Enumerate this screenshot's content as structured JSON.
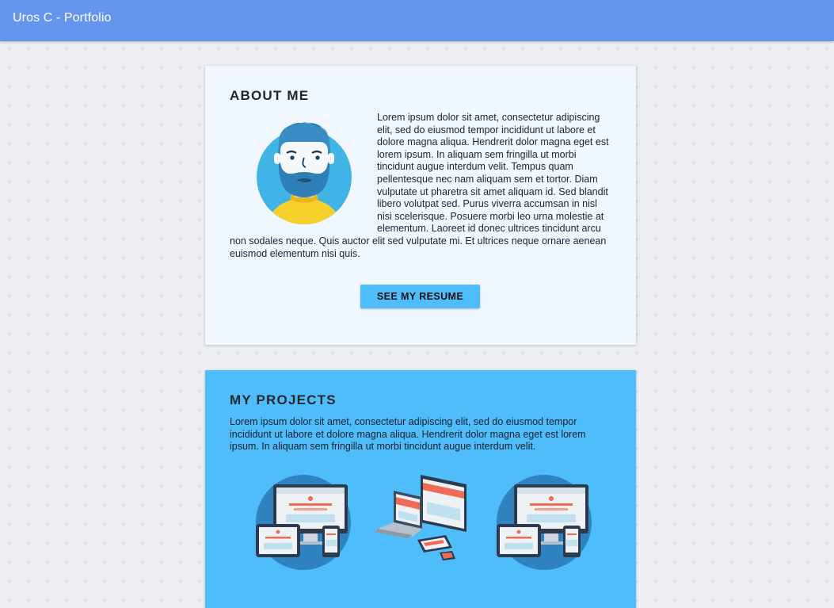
{
  "topbar": {
    "title": "Uros C - Portfolio"
  },
  "about": {
    "heading": "ABOUT ME",
    "avatar_icon": "bearded-man-avatar-icon",
    "body": "Lorem ipsum dolor sit amet, consectetur adipiscing elit, sed do eiusmod tempor incididunt ut labore et dolore magna aliqua. Hendrerit dolor magna eget est lorem ipsum. In aliquam sem fringilla ut morbi tincidunt augue interdum velit. Tempus quam pellentesque nec nam aliquam sem et tortor. Diam vulputate ut pharetra sit amet aliquam id. Sed blandit libero volutpat sed. Purus viverra accumsan in nisl nisi scelerisque. Posuere morbi leo urna molestie at elementum. Laoreet id donec ultrices tincidunt arcu non sodales neque. Quis auctor elit sed vulputate mi. Et ultrices neque ornare aenean euismod elementum nisi quis.",
    "button_label": "SEE MY RESUME"
  },
  "projects": {
    "heading": "MY PROJECTS",
    "body": "Lorem ipsum dolor sit amet, consectetur adipiscing elit, sed do eiusmod tempor incididunt ut labore et dolore magna aliqua. Hendrerit dolor magna eget est lorem ipsum. In aliquam sem fringilla ut morbi tincidunt augue interdum velit.",
    "images": [
      "responsive-devices-icon",
      "isometric-devices-icon",
      "responsive-devices-icon"
    ]
  },
  "colors": {
    "topbar": "#6594ec",
    "accent": "#50bdfb",
    "about_card": "#f0f7ff",
    "page_bg": "#eceef2"
  }
}
